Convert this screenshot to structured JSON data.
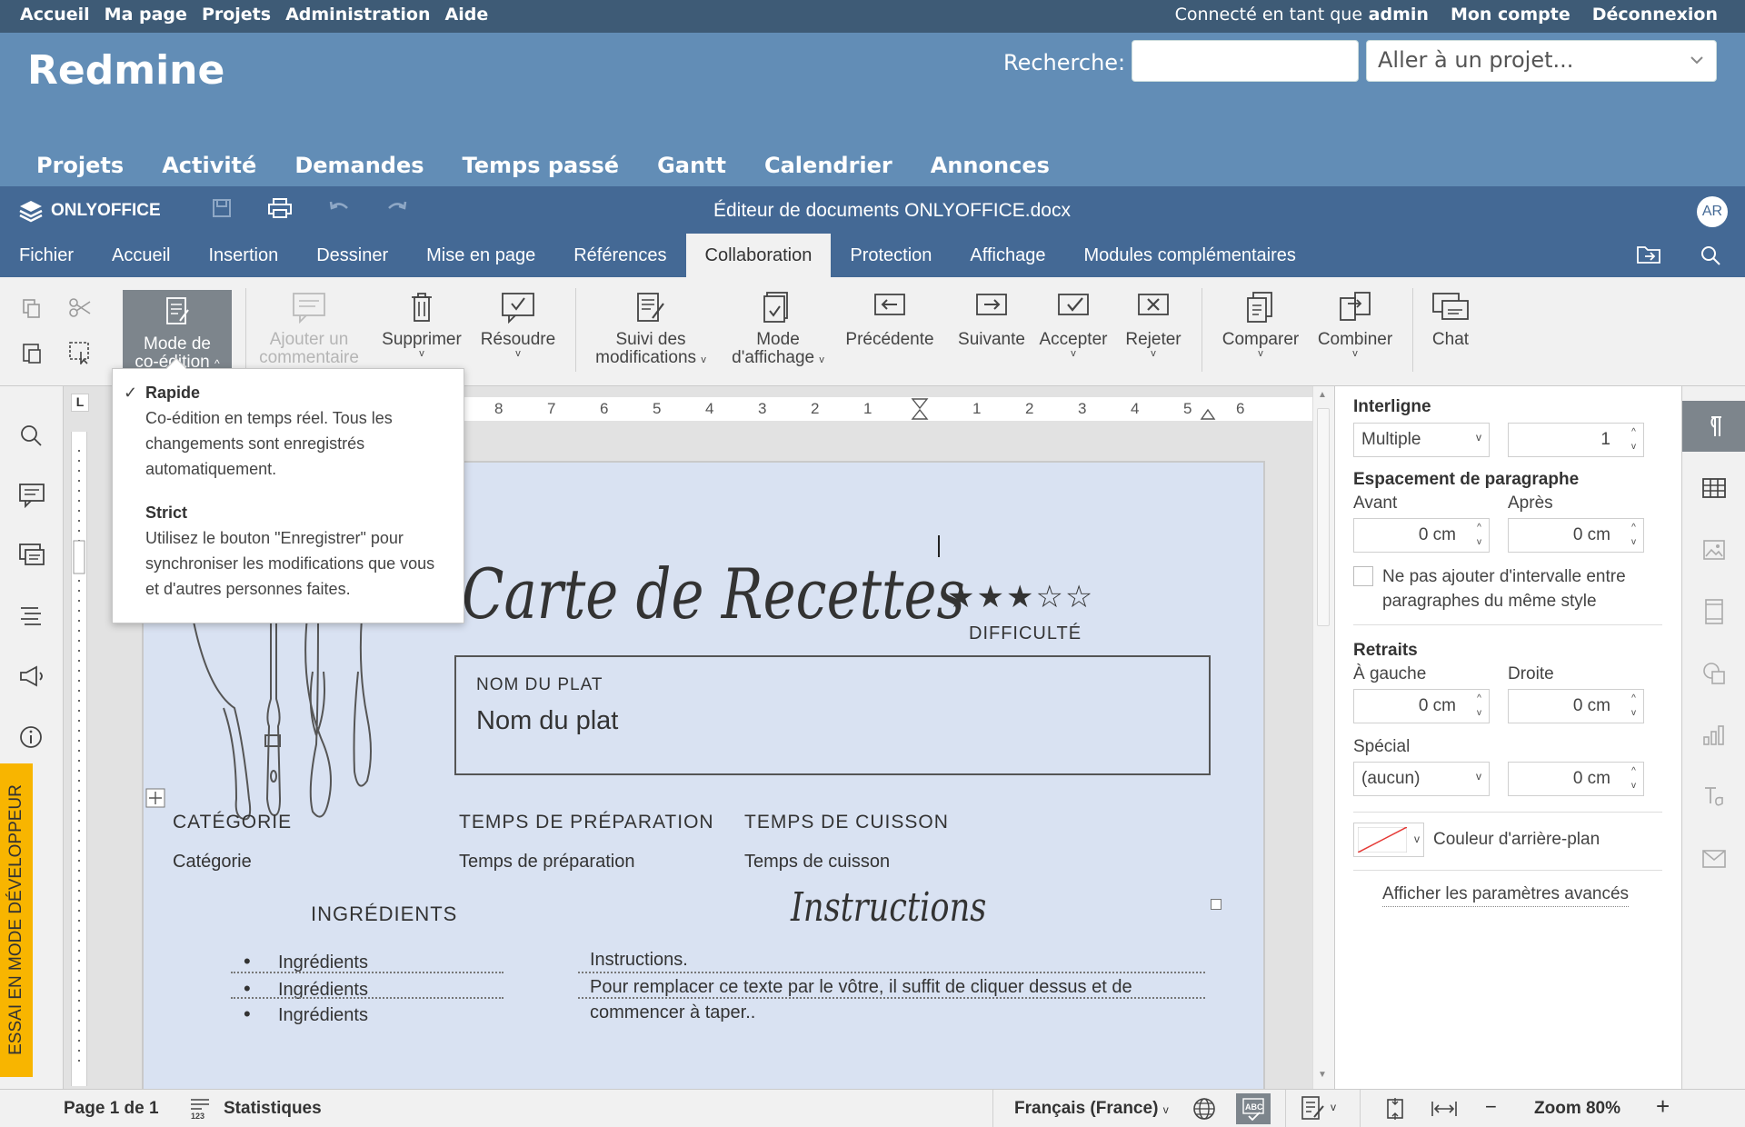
{
  "redmine": {
    "top_left": [
      "Accueil",
      "Ma page",
      "Projets",
      "Administration",
      "Aide"
    ],
    "logged_prefix": "Connecté en tant que",
    "logged_user": "admin",
    "my_account": "Mon compte",
    "logout": "Déconnexion",
    "title": "Redmine",
    "search_label": "Recherche:",
    "search_value": "",
    "jump_placeholder": "Aller à un projet...",
    "menu": [
      "Projets",
      "Activité",
      "Demandes",
      "Temps passé",
      "Gantt",
      "Calendrier",
      "Annonces"
    ]
  },
  "editor": {
    "logo": "ONLYOFFICE",
    "doc_title": "Éditeur de documents ONLYOFFICE.docx",
    "avatar": "AR",
    "tabs": [
      "Fichier",
      "Accueil",
      "Insertion",
      "Dessiner",
      "Mise en page",
      "Références",
      "Collaboration",
      "Protection",
      "Affichage",
      "Modules complémentaires"
    ],
    "active_tab": "Collaboration",
    "toolbar": {
      "coedit_l1": "Mode de",
      "coedit_l2": "co-édition",
      "comment_l1": "Ajouter un",
      "comment_l2": "commentaire",
      "delete": "Supprimer",
      "resolve": "Résoudre",
      "track_l1": "Suivi des",
      "track_l2": "modifications",
      "display_l1": "Mode",
      "display_l2": "d'affichage",
      "previous": "Précédente",
      "next": "Suivante",
      "accept": "Accepter",
      "reject": "Rejeter",
      "compare": "Comparer",
      "combine": "Combiner",
      "chat": "Chat"
    }
  },
  "popover": {
    "fast_title": "Rapide",
    "fast_desc": "Co-édition en temps réel. Tous les changements sont enregistrés automatiquement.",
    "strict_title": "Strict",
    "strict_desc": "Utilisez le bouton \"Enregistrer\" pour synchroniser les modifications que vous et d'autres personnes faites.",
    "selected": "Rapide"
  },
  "ruler_numbers": [
    "8",
    "7",
    "6",
    "5",
    "4",
    "3",
    "2",
    "1",
    "1",
    "2",
    "3",
    "4",
    "5",
    "6"
  ],
  "dev_banner": "ESSAI EN MODE DÉVELOPPEUR",
  "document": {
    "title": "Carte de Recettes",
    "stars": "★★★☆☆",
    "difficulty": "DIFFICULTÉ",
    "name_label": "NOM DU PLAT",
    "name_value": "Nom du plat",
    "category_label": "CATÉGORIE",
    "category_value": "Catégorie",
    "prep_label": "TEMPS DE PRÉPARATION",
    "prep_value": "Temps de préparation",
    "cook_label": "TEMPS DE CUISSON",
    "cook_value": "Temps de cuisson",
    "ingredients_title": "INGRÉDIENTS",
    "ingredients": [
      "Ingrédients",
      "Ingrédients",
      "Ingrédients"
    ],
    "instructions_title": "Instructions",
    "instructions": [
      "Instructions.",
      "Pour remplacer ce texte par le vôtre, il suffit de cliquer dessus et de",
      "commencer à taper.."
    ]
  },
  "panel": {
    "line_spacing": "Interligne",
    "line_spacing_mode": "Multiple",
    "line_spacing_value": "1",
    "para_spacing": "Espacement de paragraphe",
    "before": "Avant",
    "after": "Après",
    "before_value": "0 cm",
    "after_value": "0 cm",
    "no_interval": "Ne pas ajouter d'intervalle entre paragraphes du même style",
    "indents": "Retraits",
    "left": "À gauche",
    "right": "Droite",
    "left_value": "0 cm",
    "right_value": "0 cm",
    "special": "Spécial",
    "special_mode": "(aucun)",
    "special_value": "0 cm",
    "bg_color": "Couleur d'arrière-plan",
    "advanced": "Afficher les paramètres avancés"
  },
  "status": {
    "page": "Page 1 de 1",
    "stats": "Statistiques",
    "language": "Français (France)",
    "zoom": "Zoom 80%"
  }
}
